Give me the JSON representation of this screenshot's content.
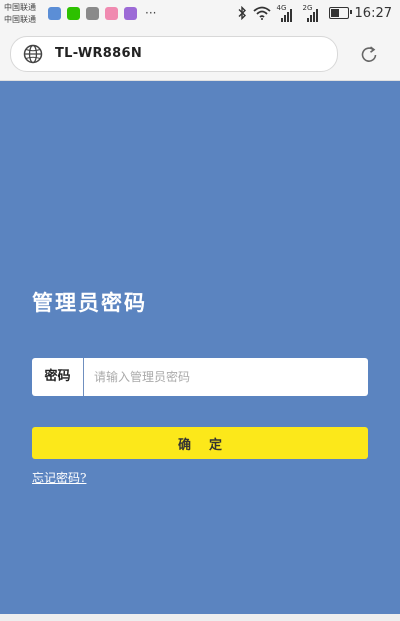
{
  "statusbar": {
    "carrier_line1": "中国联通",
    "carrier_line2": "中国联通",
    "app_icons": [
      {
        "name": "notification-app-icon",
        "color": "#5b8ed6"
      },
      {
        "name": "wechat-icon",
        "color": "#2dc100"
      },
      {
        "name": "gallery-icon",
        "color": "#8a8a8a"
      },
      {
        "name": "notes-icon",
        "color": "#f08ab0"
      },
      {
        "name": "purple-app-icon",
        "color": "#9c6ad6"
      }
    ],
    "more": "···",
    "signal_4g": "4G",
    "signal_2g": "2G",
    "battery_level": 0.6,
    "time": "16:27"
  },
  "browser": {
    "url": "TL-WR886N"
  },
  "login": {
    "title": "管理员密码",
    "password_label": "密码",
    "password_placeholder": "请输入管理员密码",
    "password_value": "",
    "confirm_label": "确定",
    "forgot_link": "忘记密码?"
  },
  "colors": {
    "background": "#5b84c0",
    "button": "#fce81a"
  }
}
